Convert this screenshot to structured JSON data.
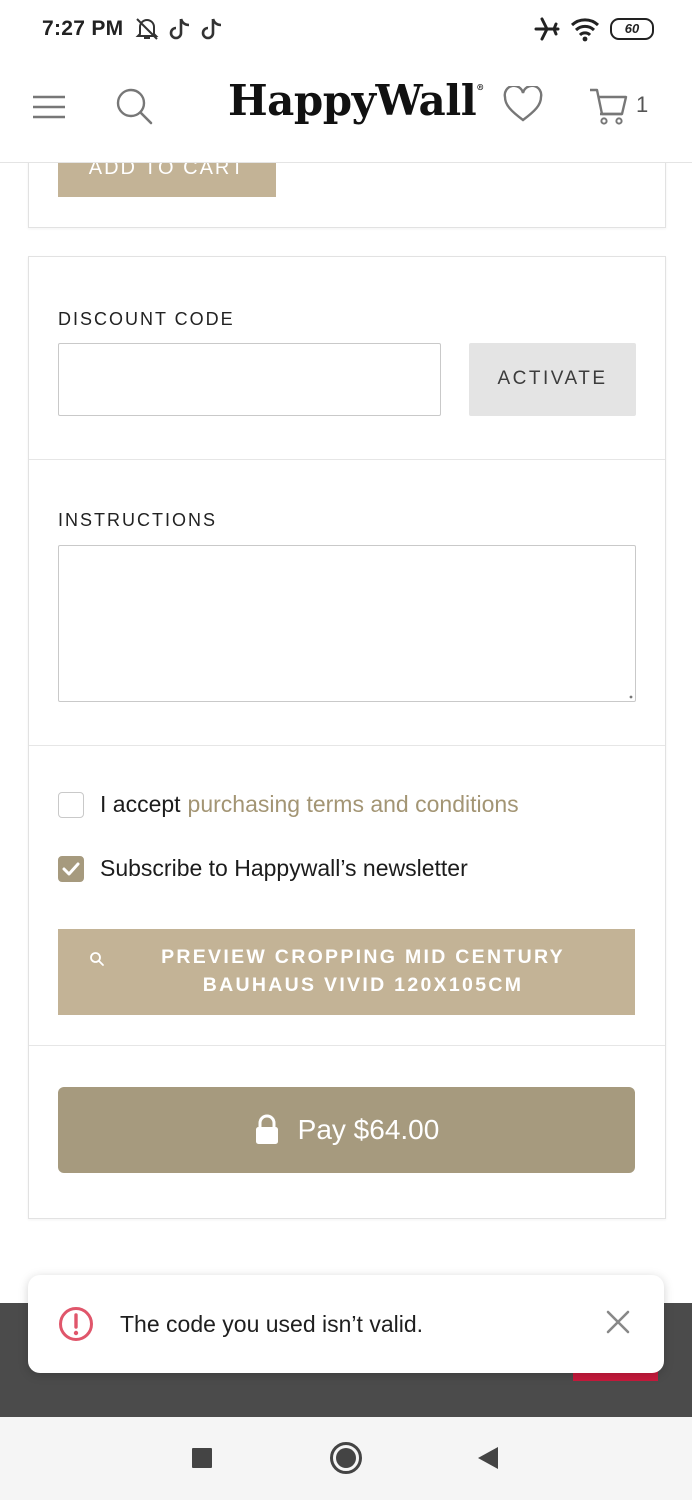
{
  "status_bar": {
    "time": "7:27 PM",
    "battery": "60",
    "icons": [
      "muted-bell-icon",
      "tiktok-icon",
      "tiktok-icon",
      "airplane-icon",
      "wifi-icon",
      "battery-icon"
    ]
  },
  "header": {
    "brand": "HappyWall",
    "brand_mark": "®",
    "cart_count": "1",
    "icons": [
      "menu-icon",
      "search-icon",
      "heart-icon",
      "cart-icon"
    ]
  },
  "top_card": {
    "add_to_cart_label": "ADD TO CART"
  },
  "checkout": {
    "discount_label": "DISCOUNT CODE",
    "discount_value": "",
    "activate_label": "ACTIVATE",
    "instructions_label": "INSTRUCTIONS",
    "instructions_value": "",
    "terms_prefix": "I accept",
    "terms_link": "purchasing terms and conditions",
    "terms_checked": false,
    "newsletter_label": "Subscribe to Happywall’s newsletter",
    "newsletter_checked": true,
    "preview_line1": "PREVIEW CROPPING MID CENTURY",
    "preview_line2": "BAUHAUS VIVID 120X105CM",
    "pay_label": "Pay $64.00"
  },
  "toast": {
    "message": "The code you used isn’t valid."
  },
  "colors": {
    "accent_light": "#c3b396",
    "accent_dark": "#a69a7e",
    "link": "#a39574",
    "error": "#e0566b",
    "footer": "#4b4b4b"
  }
}
